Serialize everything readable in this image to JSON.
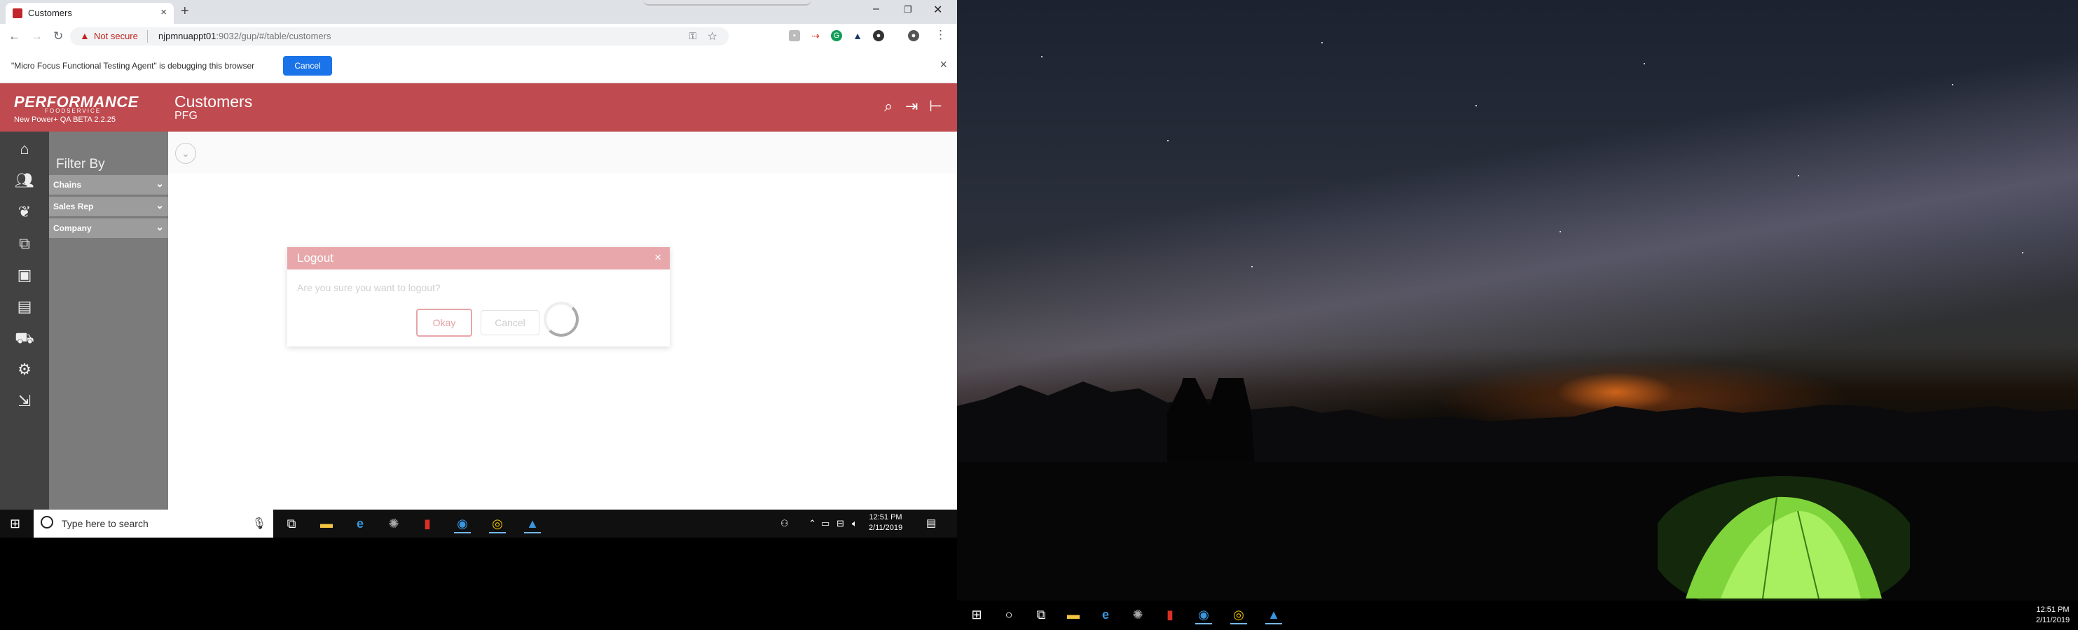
{
  "browser": {
    "tab_title": "Customers",
    "new_tab": "+",
    "tab_close": "×",
    "window_minimize": "–",
    "window_restore": "❐",
    "window_close": "✕",
    "not_secure": "Not secure",
    "url_host": "njpmnuappt01",
    "url_path": ":9032/gup/#/table/customers"
  },
  "debug_bar": {
    "message": "\"Micro Focus Functional Testing Agent\" is debugging this browser",
    "cancel_label": "Cancel",
    "close": "×"
  },
  "app": {
    "logo_text": "PERFORMANCE",
    "logo_sub": "FOODSERVICE",
    "version": "New Power+ QA BETA 2.2.25",
    "page_title": "Customers",
    "page_subtitle": "PFG",
    "header_icons": [
      "search-icon",
      "logout-icon",
      "hierarchy-icon"
    ]
  },
  "sidebar": {
    "icons": [
      "home-icon",
      "customers-icon",
      "products-icon",
      "tags-icon",
      "archive-icon",
      "document-icon",
      "cart-icon",
      "settings-icon",
      "exit-icon"
    ]
  },
  "filter": {
    "title": "Filter By",
    "facets": [
      {
        "label": "Chains"
      },
      {
        "label": "Sales Rep"
      },
      {
        "label": "Company"
      }
    ]
  },
  "modal": {
    "title": "Logout",
    "close": "×",
    "question": "Are you sure you want to logout?",
    "okay_label": "Okay",
    "cancel_label": "Cancel"
  },
  "taskbar_left": {
    "search_placeholder": "Type here to search",
    "time": "12:51 PM",
    "date": "2/11/2019"
  },
  "taskbar_right": {
    "time": "12:51 PM",
    "date": "2/11/2019"
  },
  "colors": {
    "brand_red": "#bf4a4f",
    "sidenav": "#424242",
    "filter_panel": "#7b7b7b",
    "chrome_blue": "#1a73e8"
  }
}
